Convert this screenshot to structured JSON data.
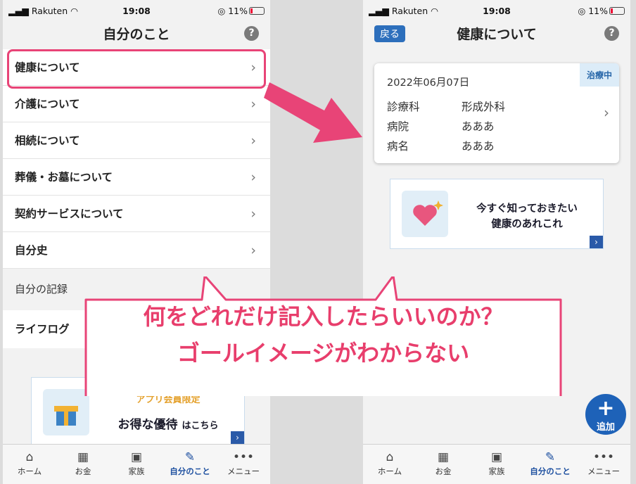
{
  "status_bar": {
    "carrier": "Rakuten",
    "time": "19:08",
    "battery": "11%"
  },
  "left": {
    "title": "自分のこと",
    "help": "?",
    "menu": [
      "健康について",
      "介護について",
      "相続について",
      "葬儀・お墓について",
      "契約サービスについて",
      "自分史"
    ],
    "section_label": "自分の記録",
    "record_item": "ライフログ",
    "banner": {
      "line1": "アプリ会員限定",
      "line2": "お得な優待",
      "line2_suffix": "はこちら"
    }
  },
  "right": {
    "back": "戻る",
    "title": "健康について",
    "help": "?",
    "card": {
      "date": "2022年06月07日",
      "badge": "治療中",
      "rows": [
        {
          "label": "診療科",
          "value": "形成外科"
        },
        {
          "label": "病院",
          "value": "あああ"
        },
        {
          "label": "病名",
          "value": "あああ"
        }
      ]
    },
    "banner": {
      "line1": "今すぐ知っておきたい",
      "line2": "健康のあれこれ"
    },
    "fab_label": "追加"
  },
  "tabs": [
    {
      "label": "ホーム",
      "icon": "home-icon",
      "glyph": "⌂"
    },
    {
      "label": "お金",
      "icon": "calculator-icon",
      "glyph": "▦"
    },
    {
      "label": "家族",
      "icon": "contacts-icon",
      "glyph": "▣"
    },
    {
      "label": "自分のこと",
      "icon": "notebook-pen-icon",
      "glyph": "✎"
    },
    {
      "label": "メニュー",
      "icon": "more-icon",
      "glyph": "•••"
    }
  ],
  "callout": {
    "line1": "何をどれだけ記入したらいいのか？",
    "line2": "ゴールイメージがわからない"
  },
  "colors": {
    "accent": "#e84477",
    "primary": "#1e62b8",
    "callout_text": "#e83e6c"
  }
}
